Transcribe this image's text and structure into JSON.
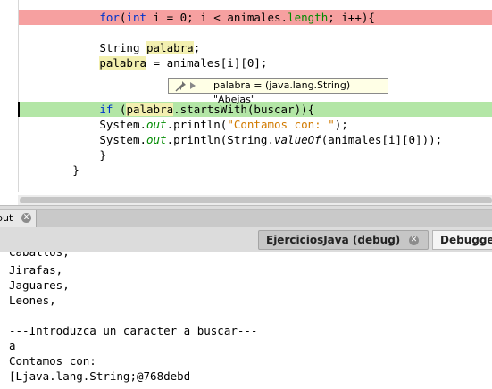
{
  "editor": {
    "lines": [
      {
        "indent": "    ",
        "kw1": "for",
        "p1": "(",
        "kw2": "int",
        "p2": " i = 0; i < animales.",
        "prop": "length",
        "p3": "; i++){"
      },
      {
        "type": "String ",
        "var": "palabra",
        "rest": ";"
      },
      {
        "var": "palabra",
        "rest": " = animales[i][0];"
      },
      {
        "kw": "if",
        "p1": " (",
        "var": "palabra",
        "rest": ".startsWith(buscar)){"
      },
      {
        "p1": "System.",
        "field": "out",
        "rest": ".println(",
        "str": "\"Contamos con: \"",
        "end": ");"
      },
      {
        "p1": "System.",
        "field": "out",
        "rest": ".println(String.",
        "method": "valueOf",
        "end": "(animales[i][0]));"
      },
      {
        "brace1": "}"
      },
      {
        "brace2": "}"
      }
    ],
    "tooltip": "palabra = (java.lang.String) \"Abejas\""
  },
  "output_tab": {
    "label": "put"
  },
  "session_tabs": [
    {
      "label": "EjerciciosJava (debug)"
    },
    {
      "label": "Debugge"
    }
  ],
  "console": {
    "lines": [
      "Jirafas,",
      "Jaguares,",
      "Leones,",
      "",
      "---Introduzca un caracter a buscar---",
      "a",
      "Contamos con:",
      "[Ljava.lang.String;@768debd"
    ],
    "partial_top": "Caballos,"
  },
  "colors": {
    "breakpoint_line": "#f6a0a0",
    "current_line": "#b3e6a6",
    "keyword": "#0033cc",
    "string": "#d17a00",
    "field": "#008a00"
  },
  "icons": [
    "pin-icon",
    "expand-arrow-icon",
    "close-icon"
  ]
}
